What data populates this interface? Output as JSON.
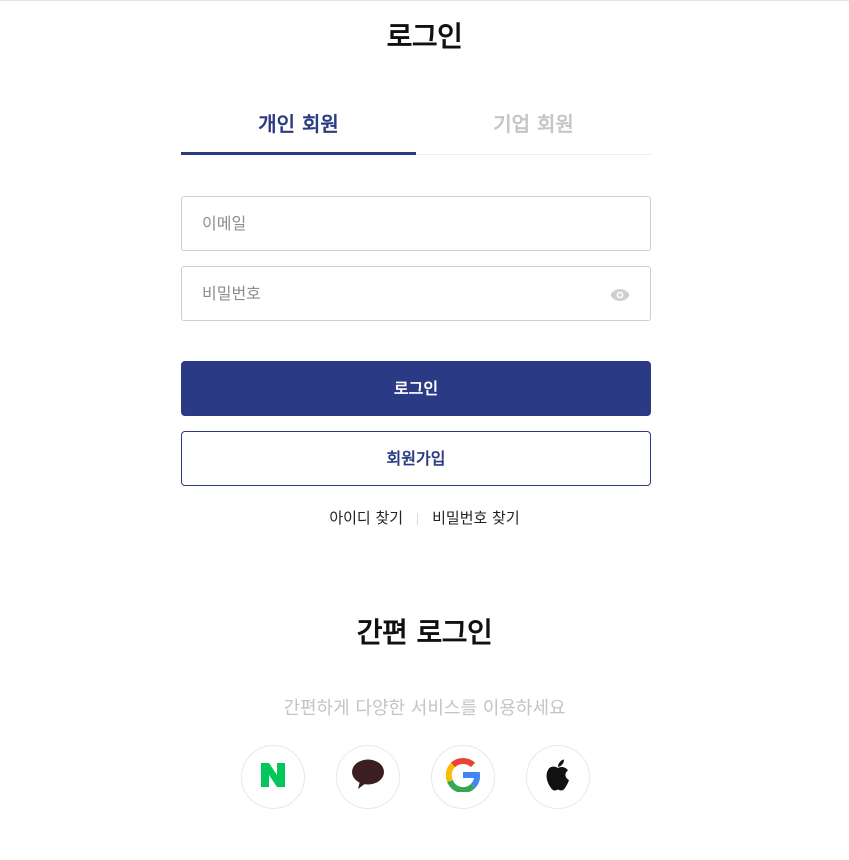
{
  "page": {
    "title": "로그인"
  },
  "tabs": [
    {
      "label": "개인 회원",
      "active": true
    },
    {
      "label": "기업 회원",
      "active": false
    }
  ],
  "form": {
    "email_placeholder": "이메일",
    "password_placeholder": "비밀번호",
    "password_toggle_icon": "eye-icon"
  },
  "buttons": {
    "login": "로그인",
    "signup": "회원가입"
  },
  "links": {
    "find_id": "아이디 찾기",
    "find_password": "비밀번호 찾기"
  },
  "easy_login": {
    "title": "간편 로그인",
    "subtitle": "간편하게 다양한 서비스를 이용하세요",
    "providers": [
      {
        "name": "naver",
        "icon": "naver-icon"
      },
      {
        "name": "kakao",
        "icon": "kakao-icon"
      },
      {
        "name": "google",
        "icon": "google-icon"
      },
      {
        "name": "apple",
        "icon": "apple-icon"
      }
    ]
  },
  "colors": {
    "primary": "#2b3a85",
    "naver": "#03c75a",
    "kakao": "#3c1e1e"
  }
}
